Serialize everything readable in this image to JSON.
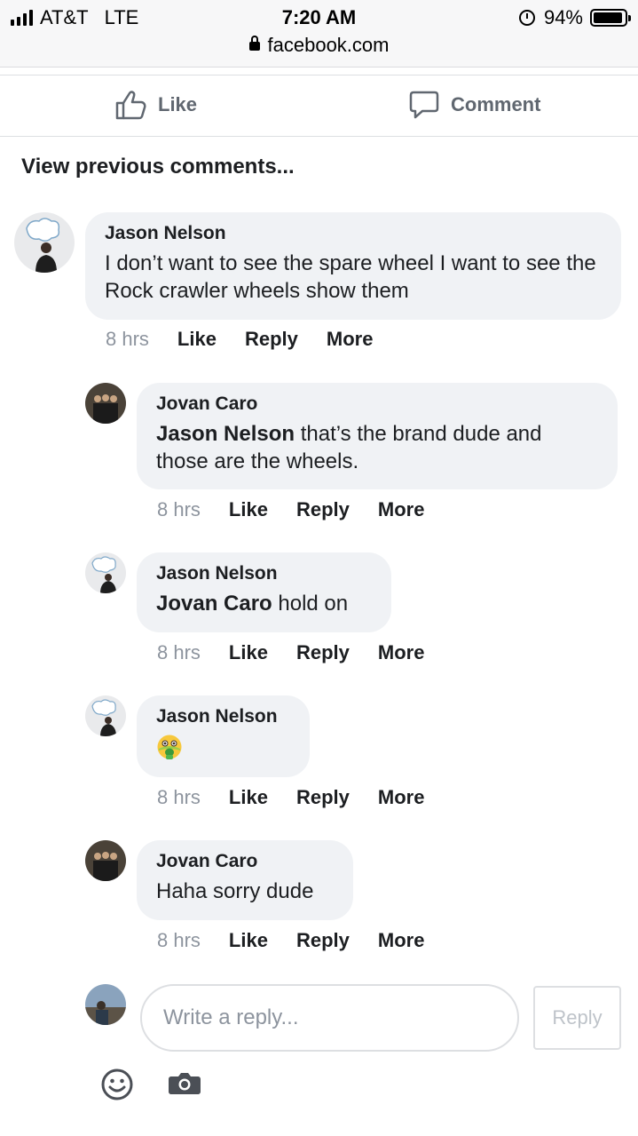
{
  "status_bar": {
    "carrier": "AT&T",
    "network": "LTE",
    "time": "7:20 AM",
    "battery": "94%",
    "battery_level": 0.94,
    "icons": [
      "signal-icon",
      "alarm-icon",
      "battery-icon"
    ]
  },
  "browser": {
    "url": "facebook.com",
    "icon": "lock-icon"
  },
  "post_actions": {
    "like_label": "Like",
    "comment_label": "Comment",
    "like_icon": "thumbs-up-icon",
    "comment_icon": "speech-bubble-icon"
  },
  "view_previous": "View previous comments...",
  "comments": [
    {
      "author": "Jason Nelson",
      "mention": "",
      "text": "I don’t want to see the spare wheel I want to see the Rock crawler wheels show them",
      "time": "8 hrs",
      "like": "Like",
      "reply": "Reply",
      "more": "More"
    },
    {
      "author": "Jovan Caro",
      "mention": "Jason Nelson",
      "text": " that’s the brand dude and those are the wheels.",
      "time": "8 hrs",
      "like": "Like",
      "reply": "Reply",
      "more": "More"
    },
    {
      "author": "Jason Nelson",
      "mention": "Jovan Caro",
      "text": " hold on",
      "time": "8 hrs",
      "like": "Like",
      "reply": "Reply",
      "more": "More"
    },
    {
      "author": "Jason Nelson",
      "mention": "",
      "text": "🤮",
      "time": "8 hrs",
      "like": "Like",
      "reply": "Reply",
      "more": "More"
    },
    {
      "author": "Jovan Caro",
      "mention": "",
      "text": "Haha sorry dude",
      "time": "8 hrs",
      "like": "Like",
      "reply": "Reply",
      "more": "More"
    }
  ],
  "composer": {
    "placeholder": "Write a reply...",
    "value": "",
    "submit_label": "Reply",
    "icons": [
      "emoji-icon",
      "camera-icon"
    ]
  },
  "colors": {
    "bubble": "#f0f2f5",
    "secondary_text": "#8d949e",
    "action_text": "#606770",
    "divider": "#dddfe2"
  }
}
